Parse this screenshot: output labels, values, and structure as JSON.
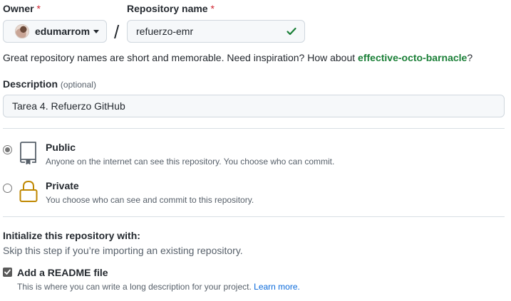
{
  "owner": {
    "label": "Owner",
    "required_mark": "*",
    "selected": "edumarrom"
  },
  "repo": {
    "label": "Repository name",
    "required_mark": "*",
    "value": "refuerzo-emr",
    "valid": true
  },
  "separator": "/",
  "hint": {
    "text": "Great repository names are short and memorable. Need inspiration? How about ",
    "suggestion": "effective-octo-barnacle",
    "suffix": "?"
  },
  "description": {
    "label": "Description",
    "optional": "(optional)",
    "value": "Tarea 4. Refuerzo GitHub"
  },
  "visibility": {
    "selected": "public",
    "public": {
      "title": "Public",
      "desc": "Anyone on the internet can see this repository. You choose who can commit."
    },
    "private": {
      "title": "Private",
      "desc": "You choose who can see and commit to this repository."
    }
  },
  "initialize": {
    "title": "Initialize this repository with:",
    "subtitle": "Skip this step if you’re importing an existing repository.",
    "readme": {
      "label": "Add a README file",
      "checked": true,
      "desc": "This is where you can write a long description for your project. ",
      "link": "Learn more."
    }
  },
  "colors": {
    "success": "#1a7f37",
    "link": "#0969da",
    "required": "#cf222e",
    "lock": "#bf8700"
  }
}
